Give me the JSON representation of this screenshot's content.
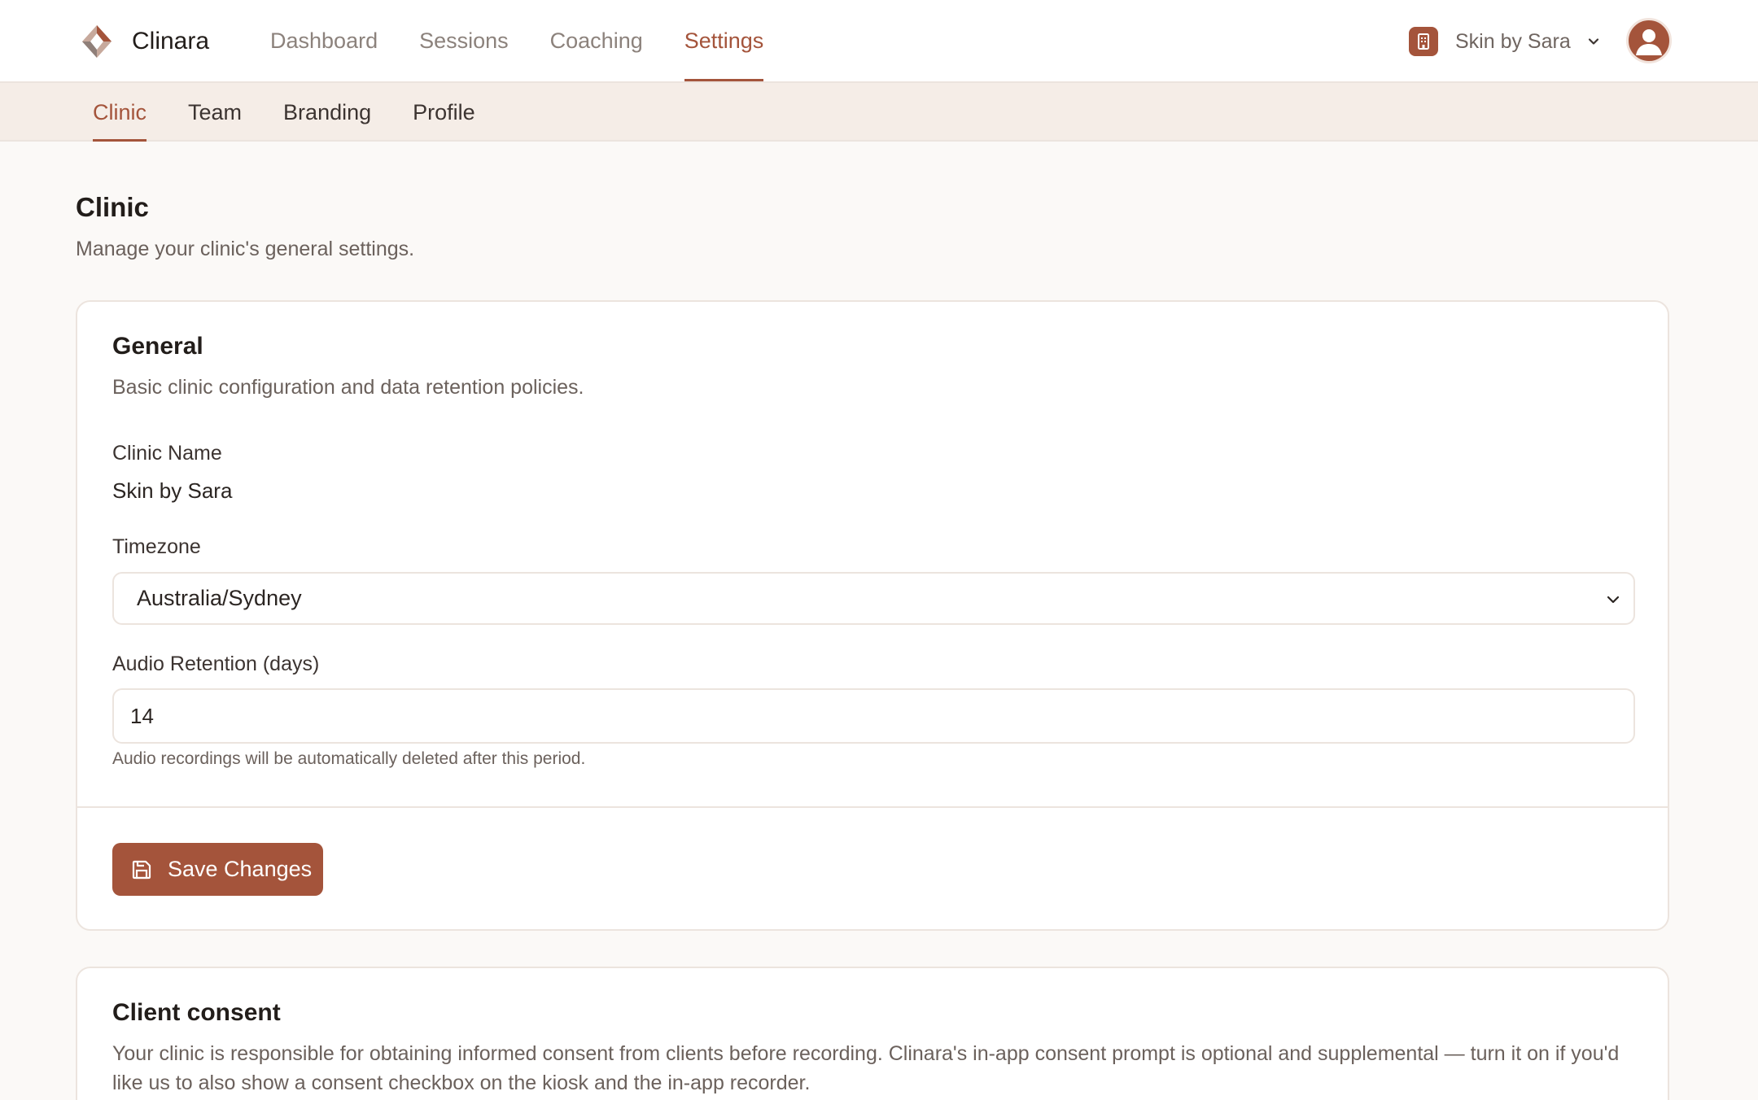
{
  "app": {
    "name": "Clinara"
  },
  "nav": {
    "items": [
      {
        "label": "Dashboard",
        "active": false
      },
      {
        "label": "Sessions",
        "active": false
      },
      {
        "label": "Coaching",
        "active": false
      },
      {
        "label": "Settings",
        "active": true
      }
    ]
  },
  "clinic_switcher": {
    "label": "Skin by Sara"
  },
  "subtabs": [
    {
      "label": "Clinic",
      "active": true
    },
    {
      "label": "Team",
      "active": false
    },
    {
      "label": "Branding",
      "active": false
    },
    {
      "label": "Profile",
      "active": false
    }
  ],
  "page": {
    "title": "Clinic",
    "description": "Manage your clinic's general settings."
  },
  "general": {
    "title": "General",
    "description": "Basic clinic configuration and data retention policies.",
    "clinic_name_label": "Clinic Name",
    "clinic_name_value": "Skin by Sara",
    "timezone_label": "Timezone",
    "timezone_value": "Australia/Sydney",
    "retention_label": "Audio Retention (days)",
    "retention_value": "14",
    "retention_hint": "Audio recordings will be automatically deleted after this period.",
    "save_label": "Save Changes"
  },
  "consent": {
    "title": "Client consent",
    "description": "Your clinic is responsible for obtaining informed consent from clients before recording. Clinara's in-app consent prompt is optional and supplemental — turn it on if you'd like us to also show a consent checkbox on the kiosk and the in-app recorder."
  },
  "colors": {
    "accent": "#a4543b",
    "background": "#fbf9f7",
    "subnav_background": "#f5ede7",
    "border": "#ece4de"
  }
}
